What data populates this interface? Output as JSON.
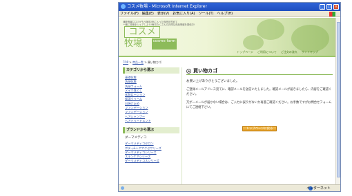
{
  "window": {
    "title": "コスメ牧場 - Microsoft Internet Explorer",
    "controls": [
      "_",
      "□",
      "×"
    ]
  },
  "menu": [
    "ファイル(F)",
    "編集(E)",
    "表示(V)",
    "お気に入り(A)",
    "ツール(T)",
    "ヘルプ(H)"
  ],
  "site": {
    "tagline_1": "通販情報口コミがもう無料!気に入った商品を貯めて",
    "tagline_2": "一緒に評価をシェアしよう!毎日たくさんのお得な商品情報を発信中!",
    "logo_top": "コスメ",
    "logo_bottom": "牧場",
    "logo_tag": "cosme farm",
    "topnav": [
      "トップページ",
      "ご利用について",
      "ご注文の流れ",
      "サイトマップ"
    ]
  },
  "breadcrumb": {
    "home": "TOP",
    "list": "商品一覧",
    "current": "買い物カゴ"
  },
  "sidebar": {
    "category_heading": "カテゴリから選ぶ",
    "categories": [
      "基礎化粧",
      "洗顔化粧",
      "洗顔フォーム",
      "メイク落とし",
      "化粧ローション",
      "保湿クリーム",
      "日焼け止め",
      "ファンデーション",
      "ファンデーション",
      "ヘアシャンプー",
      "ヘアトリートメント"
    ],
    "brand_heading": "ブランドから選ぶ",
    "brand_sub": "ダーマメディコ",
    "brands": [
      "ダーマメディコセロン",
      "ボディ&ヘアアクセサリーズ",
      "ダーマメディコシリーズ",
      "スキンケアシリーズ",
      "ダーマメディコスシリーズ"
    ]
  },
  "main": {
    "title": "買い物カゴ",
    "thanks": "お買い上げありがとうございました。",
    "msg1": "ご登録メールアドレス宛てに、確認メールを送信いたしました。確認メールが届きましたら、内容をご確認ください。",
    "msg2": "万が一メールが届かない場合は、ご入力に誤りがないか再度ご確認ください。お手数ですがお問合せフォームにてご連絡下さい。",
    "button": "トップページに戻る"
  },
  "status": {
    "zone": "インターネット"
  }
}
